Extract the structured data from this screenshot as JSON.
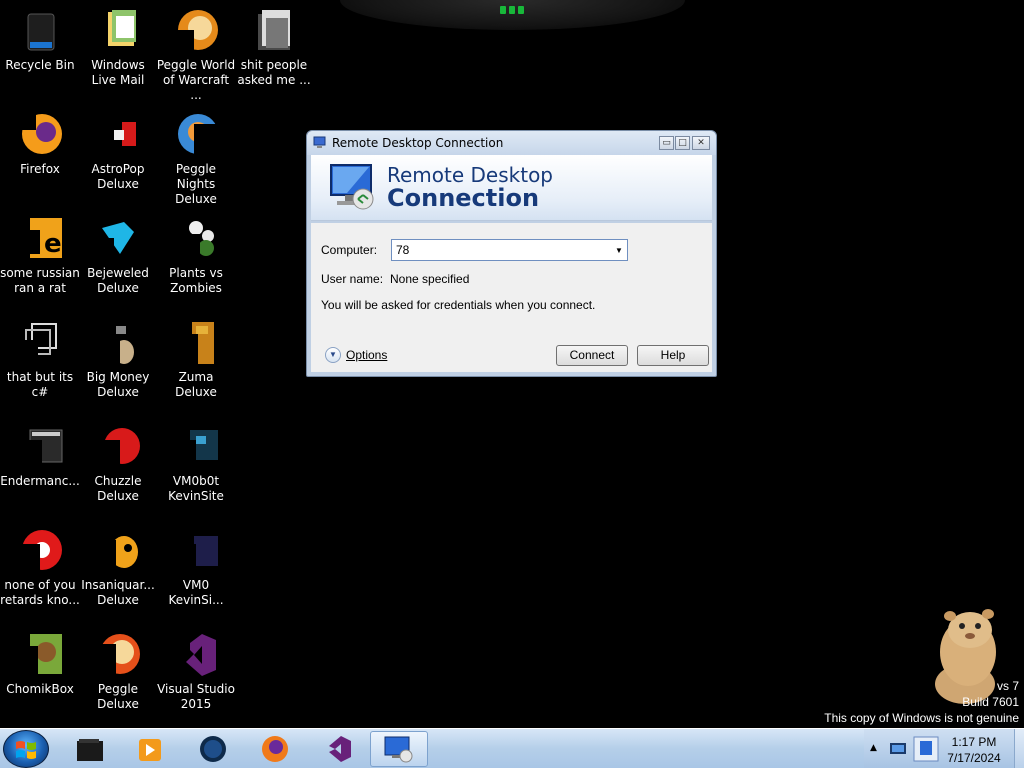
{
  "desktop": {
    "icons": [
      {
        "label": "Recycle Bin"
      },
      {
        "label": "Windows Live Mail"
      },
      {
        "label": "Peggle World of Warcraft ..."
      },
      {
        "label": "shit people asked me ..."
      },
      {
        "label": "Firefox"
      },
      {
        "label": "AstroPop Deluxe"
      },
      {
        "label": "Peggle Nights Deluxe"
      },
      {
        "label": "some russian ran a rat"
      },
      {
        "label": "Bejeweled Deluxe"
      },
      {
        "label": "Plants vs Zombies"
      },
      {
        "label": "that but its c#"
      },
      {
        "label": "Big Money Deluxe"
      },
      {
        "label": "Zuma Deluxe"
      },
      {
        "label": "Endermanc..."
      },
      {
        "label": "Chuzzle Deluxe"
      },
      {
        "label": "VM0b0t KevinSite"
      },
      {
        "label": "none of you retards kno..."
      },
      {
        "label": "Insaniquar... Deluxe"
      },
      {
        "label": "VM0 KevinSi..."
      },
      {
        "label": "ChomikBox"
      },
      {
        "label": "Peggle Deluxe"
      },
      {
        "label": "Visual Studio 2015"
      }
    ]
  },
  "dialog": {
    "title": "Remote Desktop Connection",
    "banner_line1": "Remote Desktop",
    "banner_line2": "Connection",
    "computer_label": "Computer:",
    "computer_value": "78",
    "username_label": "User name:",
    "username_value": "None specified",
    "credentials_note": "You will be asked for credentials when you connect.",
    "options_label": "Options",
    "connect_label": "Connect",
    "help_label": "Help",
    "minimize": "▭",
    "maximize": "□",
    "close": "✕"
  },
  "watermark": {
    "line1": "vs 7",
    "line2": "Build 7601",
    "line3": "This copy of Windows is not genuine"
  },
  "taskbar": {
    "clock_time": "1:17 PM",
    "clock_date": "7/17/2024"
  },
  "colors": {
    "accent": "#173a7a",
    "taskbar": "#b5cfe9"
  }
}
